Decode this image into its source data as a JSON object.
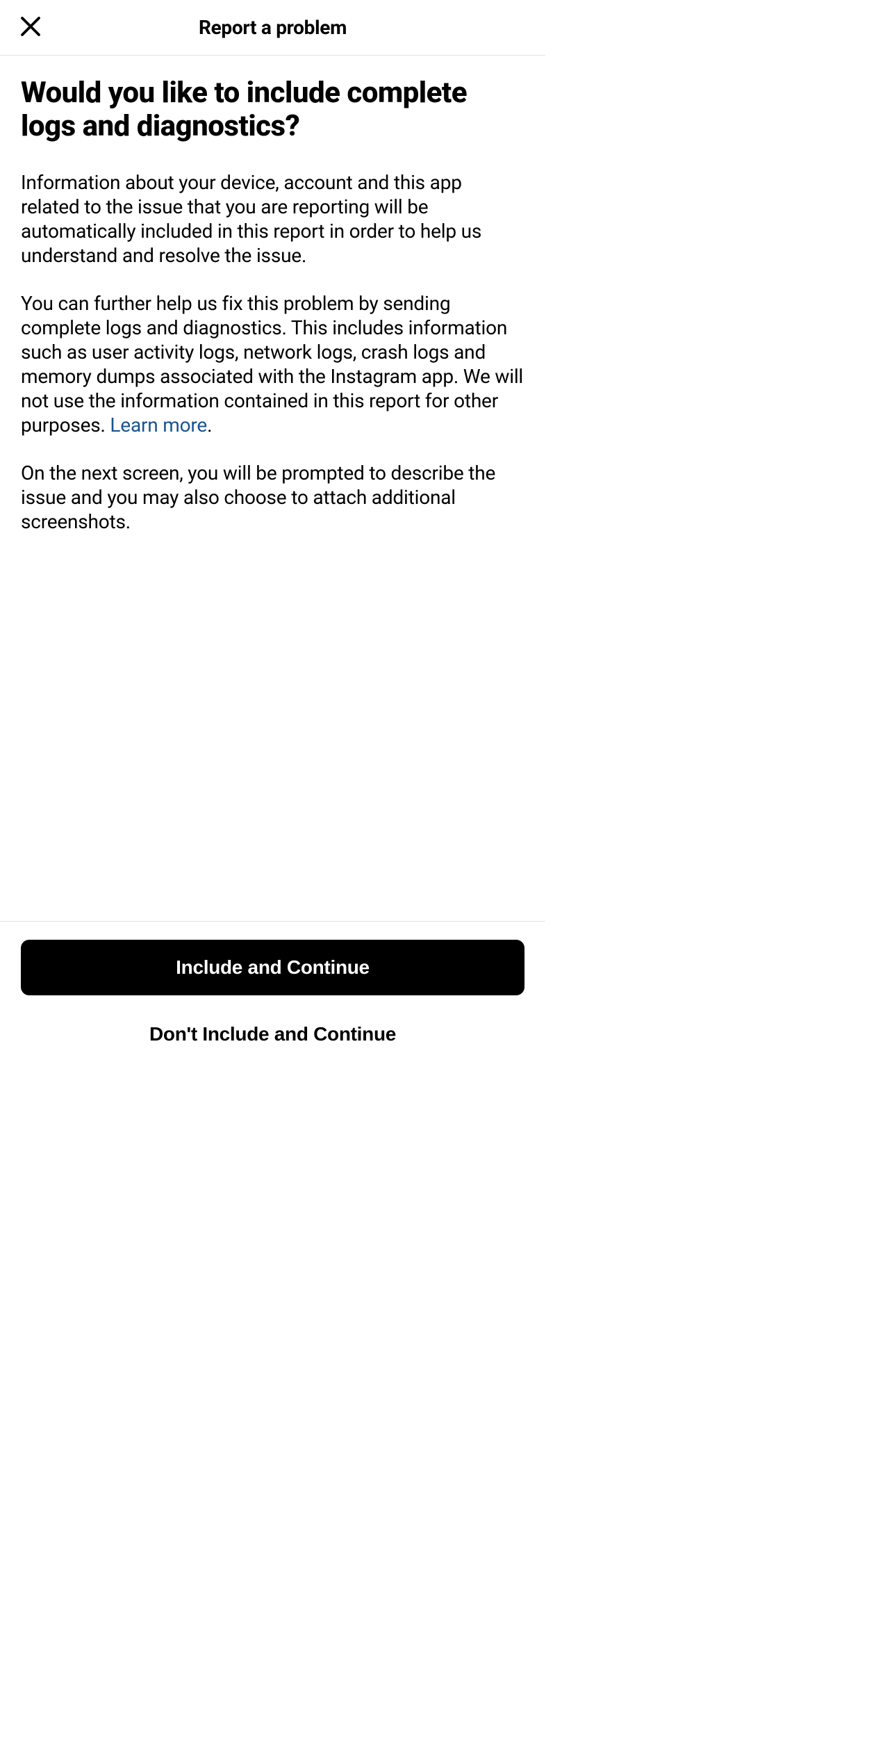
{
  "header": {
    "title": "Report a problem"
  },
  "content": {
    "question": "Would you like to include complete logs and diagnostics?",
    "paragraph1": "Information about your device, account and this app related to the issue that you are reporting will be automatically included in this report in order to help us understand and resolve the issue.",
    "paragraph2_part1": "You can further help us fix this problem by sending complete logs and diagnostics. This includes information such as user activity logs, network logs, crash logs and memory dumps associated with the Instagram app. We will not use the information contained in this report for other purposes. ",
    "learn_more": "Learn more",
    "paragraph2_part2": ".",
    "paragraph3": "On the next screen, you will be prompted to describe the issue and you may also choose to attach additional screenshots."
  },
  "footer": {
    "primary_button": "Include and Continue",
    "secondary_button": "Don't Include and Continue"
  }
}
